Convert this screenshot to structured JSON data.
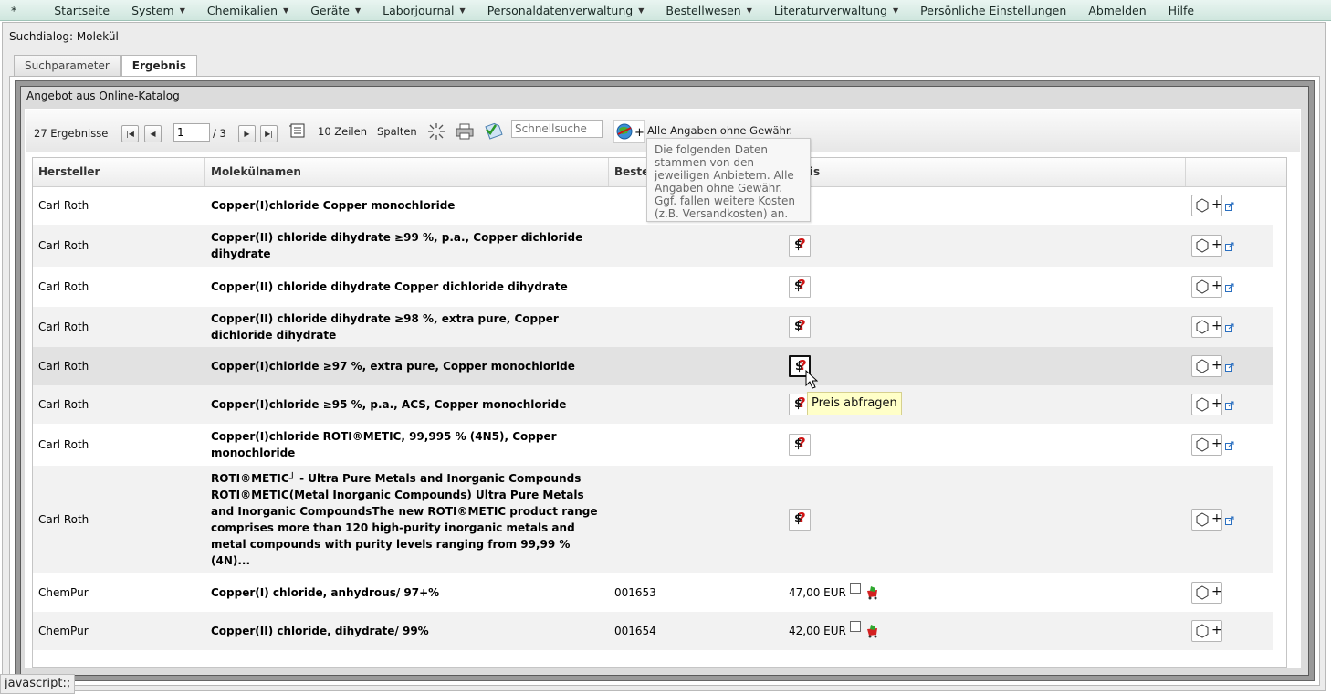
{
  "menu": [
    {
      "label": "*",
      "caret": false
    },
    {
      "label": "Startseite",
      "caret": false
    },
    {
      "label": "System",
      "caret": true
    },
    {
      "label": "Chemikalien",
      "caret": true
    },
    {
      "label": "Geräte",
      "caret": true
    },
    {
      "label": "Laborjournal",
      "caret": true
    },
    {
      "label": "Personaldatenverwaltung",
      "caret": true
    },
    {
      "label": "Bestellwesen",
      "caret": true
    },
    {
      "label": "Literaturverwaltung",
      "caret": true
    },
    {
      "label": "Persönliche Einstellungen",
      "caret": false
    },
    {
      "label": "Abmelden",
      "caret": false
    },
    {
      "label": "Hilfe",
      "caret": false
    }
  ],
  "dialog": {
    "title": "Suchdialog: Molekül"
  },
  "tabs": [
    {
      "label": "Suchparameter",
      "active": false
    },
    {
      "label": "Ergebnis",
      "active": true
    }
  ],
  "catalog": {
    "title": "Angebot aus Online-Katalog"
  },
  "toolbar": {
    "results": "27 Ergebnisse",
    "page": "1",
    "pages": "/ 3",
    "rows": "10 Zeilen",
    "columns": "Spalten",
    "search_placeholder": "Schnellsuche",
    "disclaimer": "Alle Angaben ohne Gewähr."
  },
  "tooltip": "Die folgenden Daten stammen von den jeweiligen Anbietern. Alle Angaben ohne Gewähr. Ggf. fallen weitere Kosten (z.B. Versandkosten) an.",
  "columns": {
    "manufacturer": "Hersteller",
    "names": "Molekülnamen",
    "order": "Beste",
    "price": "Preis"
  },
  "rows": [
    {
      "manufacturer": "Carl Roth",
      "name": "Copper(I)chloride Copper monochloride",
      "order": "",
      "price": "",
      "ext": true
    },
    {
      "manufacturer": "Carl Roth",
      "name": "Copper(II) chloride dihydrate ≥99 %, p.a., Copper dichloride dihydrate",
      "order": "",
      "price": "",
      "ext": true
    },
    {
      "manufacturer": "Carl Roth",
      "name": "Copper(II) chloride dihydrate Copper dichloride dihydrate",
      "order": "",
      "price": "",
      "ext": true
    },
    {
      "manufacturer": "Carl Roth",
      "name": "Copper(II) chloride dihydrate ≥98 %, extra pure, Copper dichloride dihydrate",
      "order": "",
      "price": "",
      "ext": true
    },
    {
      "manufacturer": "Carl Roth",
      "name": "Copper(I)chloride ≥97 %, extra pure, Copper monochloride",
      "order": "",
      "price": "",
      "ext": true
    },
    {
      "manufacturer": "Carl Roth",
      "name": "Copper(I)chloride ≥95 %, p.a., ACS, Copper monochloride",
      "order": "",
      "price": "",
      "ext": true
    },
    {
      "manufacturer": "Carl Roth",
      "name": "Copper(I)chloride ROTI®METIC, 99,995 % (4N5), Copper monochloride",
      "order": "",
      "price": "",
      "ext": true
    },
    {
      "manufacturer": "Carl Roth",
      "name": "ROTI®METIC┘ - Ultra Pure Metals and Inorganic Compounds ROTI®METIC(Metal Inorganic Compounds) Ultra Pure Metals and Inorganic CompoundsThe new ROTI®METIC product range comprises more than 120 high-purity inorganic metals and metal compounds with purity levels ranging from 99,99 % (4N)...",
      "order": "",
      "price": "",
      "ext": true
    },
    {
      "manufacturer": "ChemPur",
      "name": "Copper(I) chloride, anhydrous/ 97+%",
      "order": "001653",
      "price": "47,00 EUR",
      "ext": false
    },
    {
      "manufacturer": "ChemPur",
      "name": "Copper(II) chloride, dihydrate/ 99%",
      "order": "001654",
      "price": "42,00 EUR",
      "ext": false
    }
  ],
  "price_tooltip": "Preis abfragen",
  "statusbar": "javascript:;"
}
